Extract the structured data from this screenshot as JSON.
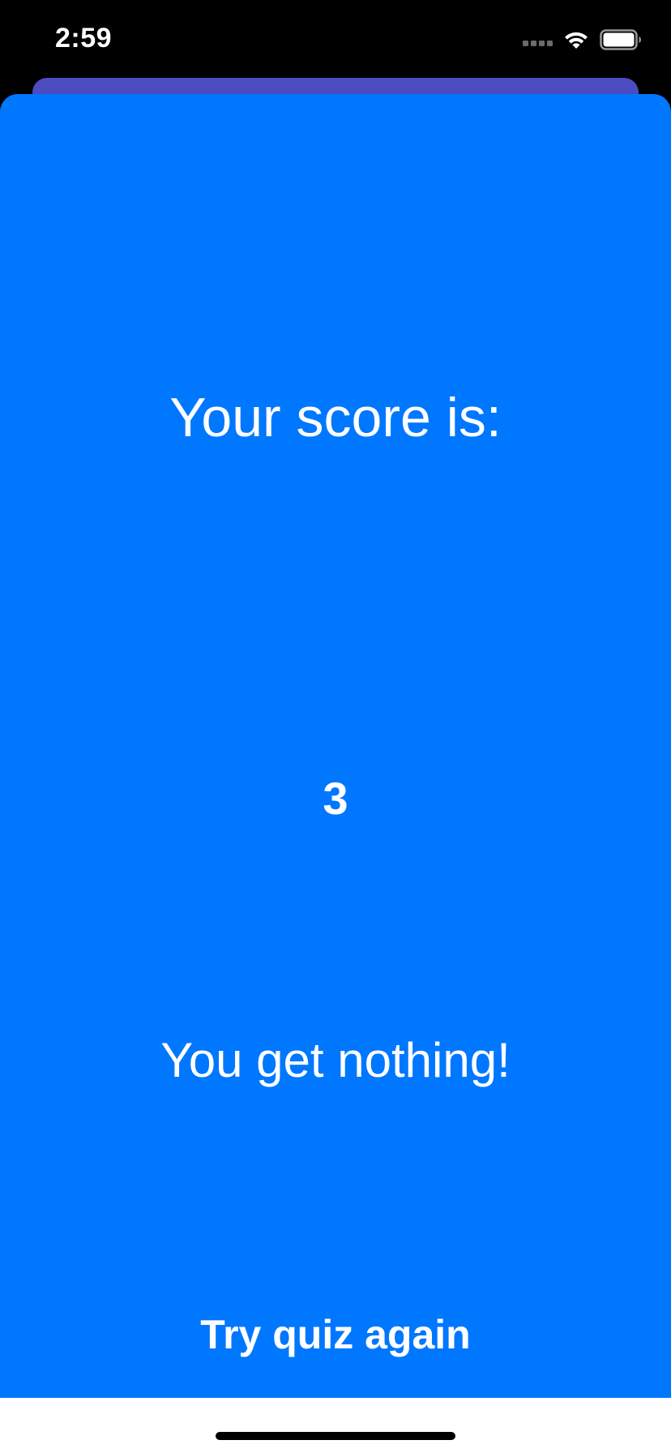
{
  "status_bar": {
    "time": "2:59",
    "icons": [
      "cellular-signal-icon",
      "wifi-icon",
      "battery-icon"
    ]
  },
  "colors": {
    "card_background": "#0077ff",
    "back_sheet": "#4c4bc0",
    "text": "#ffffff"
  },
  "result": {
    "heading": "Your score is:",
    "score": "3",
    "message": "You get nothing!",
    "try_again_label": "Try quiz again"
  }
}
